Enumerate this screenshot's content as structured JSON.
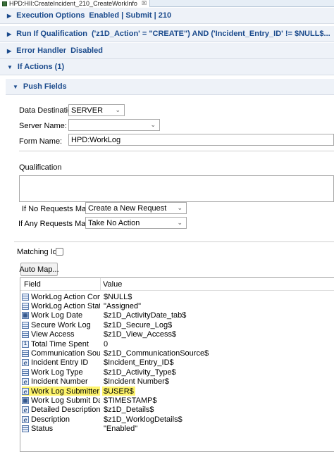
{
  "editor": {
    "tab_title": "HPD:HII:CreateIncident_210_CreateWorkInfo",
    "tab_close": "☒"
  },
  "sections": {
    "execution_options": {
      "label": "Execution Options",
      "extra": "Enabled | Submit | 210"
    },
    "run_if": {
      "label": "Run If Qualification",
      "extra": "('z1D_Action' = \"CREATE\") AND ('Incident_Entry_ID' != $NULL$..."
    },
    "error_handler": {
      "label": "Error Handler",
      "extra": "Disabled"
    },
    "if_actions": {
      "label": "If Actions (1)"
    },
    "push_fields": {
      "label": "Push Fields"
    }
  },
  "form": {
    "data_destination_label": "Data Destination:",
    "data_destination_value": "SERVER",
    "server_name_label": "Server Name:",
    "server_name_value": "",
    "form_name_label": "Form Name:",
    "form_name_value": "HPD:WorkLog",
    "qualification_label": "Qualification",
    "if_no_requests_label": "If No Requests Match:",
    "if_no_requests_value": "Create a New Request",
    "if_any_requests_label": "If Any Requests Match:",
    "if_any_requests_value": "Take No Action",
    "matching_ids_label": "Matching Ids",
    "auto_map_label": "Auto Map..."
  },
  "table": {
    "columns": [
      "Field",
      "Value"
    ],
    "rows": [
      {
        "icon": "selection-field-icon",
        "field": "WorkLog Action Com...",
        "value": "$NULL$"
      },
      {
        "icon": "selection-field-icon",
        "field": "WorkLog Action Status",
        "value": "\"Assigned\""
      },
      {
        "icon": "date-field-icon",
        "field": "Work Log Date",
        "value": "$z1D_ActivityDate_tab$"
      },
      {
        "icon": "selection-field-icon",
        "field": "Secure Work Log",
        "value": "$z1D_Secure_Log$"
      },
      {
        "icon": "selection-field-icon",
        "field": "View Access",
        "value": "$z1D_View_Access$"
      },
      {
        "icon": "integer-field-icon",
        "field": "Total Time Spent",
        "value": "0"
      },
      {
        "icon": "selection-field-icon",
        "field": "Communication Sour...",
        "value": "$z1D_CommunicationSource$"
      },
      {
        "icon": "character-field-icon",
        "field": "Incident Entry ID",
        "value": "$Incident_Entry_ID$"
      },
      {
        "icon": "selection-field-icon",
        "field": "Work Log Type",
        "value": "$z1D_Activity_Type$"
      },
      {
        "icon": "character-field-icon",
        "field": "Incident Number",
        "value": "$Incident Number$"
      },
      {
        "icon": "character-field-icon",
        "field": "Work Log Submitter",
        "value": "$USER$",
        "highlight": true
      },
      {
        "icon": "date-field-icon",
        "field": "Work Log Submit Date",
        "value": "$TIMESTAMP$"
      },
      {
        "icon": "character-field-icon",
        "field": "Detailed Description",
        "value": "$z1D_Details$"
      },
      {
        "icon": "character-field-icon",
        "field": "Description",
        "value": "$z1D_WorklogDetails$"
      },
      {
        "icon": "selection-field-icon",
        "field": "Status",
        "value": "\"Enabled\""
      }
    ]
  },
  "colors": {
    "section_text": "#1a4a8c",
    "section_bg": "#eef2f8",
    "highlight": "#fdf36b"
  }
}
